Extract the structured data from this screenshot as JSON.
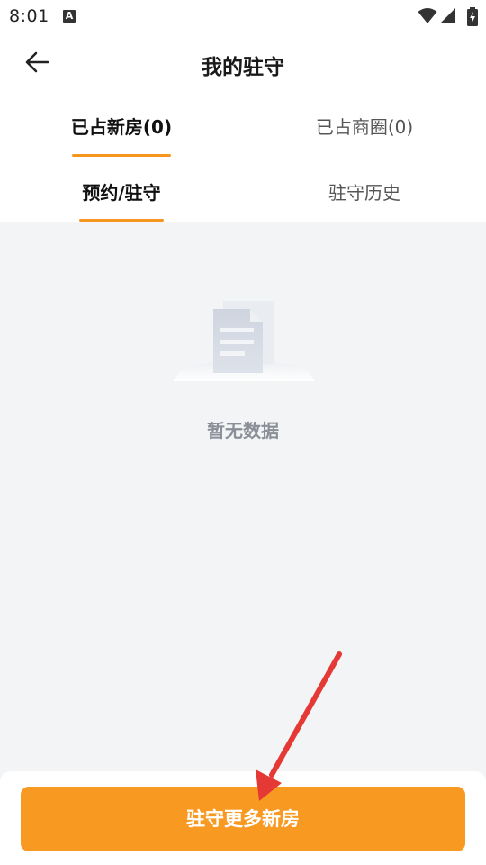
{
  "status_bar": {
    "time": "8:01",
    "notification_letter": "A",
    "icons": [
      "wifi-icon",
      "signal-icon",
      "battery-charging-icon"
    ]
  },
  "header": {
    "title": "我的驻守",
    "back_icon": "arrow-left-icon"
  },
  "primary_tabs": [
    {
      "label": "已占新房(0)",
      "active": true
    },
    {
      "label": "已占商圈(0)",
      "active": false
    }
  ],
  "secondary_tabs": [
    {
      "label": "预约/驻守",
      "active": true
    },
    {
      "label": "驻守历史",
      "active": false
    }
  ],
  "empty_state": {
    "icon": "empty-document-icon",
    "text": "暂无数据"
  },
  "bottom": {
    "button_label": "驻守更多新房"
  },
  "colors": {
    "accent": "#f7961e",
    "button": "#f89a22",
    "background": "#f3f4f6",
    "annotation": "#e53935"
  }
}
